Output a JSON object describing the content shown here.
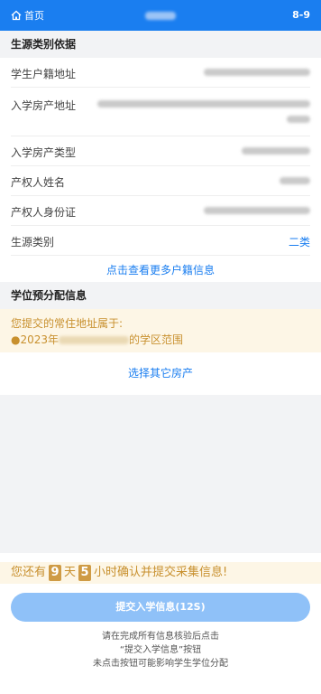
{
  "header": {
    "home_label": "首页",
    "right_label": "8-9"
  },
  "source_basis": {
    "title": "生源类别依据",
    "rows": [
      {
        "label": "学生户籍地址"
      },
      {
        "label": "入学房产地址"
      },
      {
        "label": "入学房产类型"
      },
      {
        "label": "产权人姓名"
      },
      {
        "label": "产权人身份证"
      },
      {
        "label": "生源类别",
        "value": "二类"
      }
    ],
    "more_link": "点击查看更多户籍信息"
  },
  "allocation": {
    "title": "学位预分配信息",
    "notice_line1": "您提交的常住地址属于:",
    "notice_prefix": "●2023年",
    "notice_suffix": "的学区范围",
    "choose_link": "选择其它房产"
  },
  "countdown": {
    "prefix": "您还有",
    "days": "9",
    "days_unit": "天",
    "hours": "5",
    "suffix": "小时确认并提交采集信息!"
  },
  "submit_label": "提交入学信息(12S)",
  "tips": [
    "请在完成所有信息核验后点击",
    "“提交入学信息”按钮",
    "未点击按钮可能影响学生学位分配"
  ],
  "colors": {
    "primary": "#1a7ef0",
    "warn_text": "#c8902e",
    "warn_bg": "#fdf6e6",
    "button_bg": "#8fc1f8"
  }
}
